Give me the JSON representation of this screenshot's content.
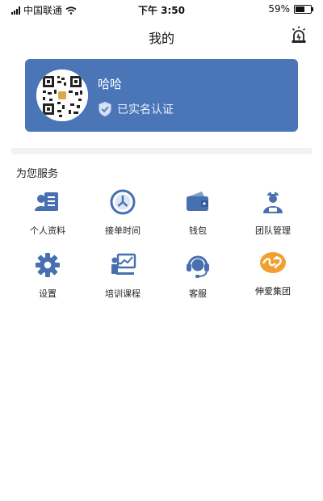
{
  "status_bar": {
    "carrier": "中国联通",
    "time": "下午 3:50",
    "battery_text": "59%",
    "battery_level": 0.59
  },
  "nav": {
    "title": "我的",
    "alarm_icon": "alarm-icon"
  },
  "profile": {
    "name": "哈哈",
    "verified_text": "已实名认证",
    "avatar_icon": "qr-code-icon",
    "badge_icon": "shield-check-icon"
  },
  "services": {
    "title": "为您服务",
    "items": [
      {
        "label": "个人资料",
        "icon": "profile-card-icon"
      },
      {
        "label": "接单时间",
        "icon": "clock-icon"
      },
      {
        "label": "钱包",
        "icon": "wallet-icon"
      },
      {
        "label": "团队管理",
        "icon": "team-icon"
      },
      {
        "label": "设置",
        "icon": "gear-icon"
      },
      {
        "label": "培训课程",
        "icon": "training-icon"
      },
      {
        "label": "客服",
        "icon": "headset-icon"
      },
      {
        "label": "伸爱集团",
        "icon": "group-logo-icon"
      }
    ]
  },
  "colors": {
    "accent": "#4a76b8",
    "icon_blue": "#4870b0",
    "logo_orange": "#f0a030"
  }
}
